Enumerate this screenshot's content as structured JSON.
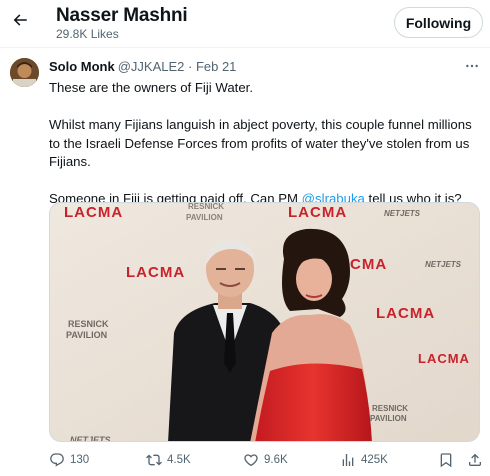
{
  "header": {
    "back_icon": "arrow-left-icon",
    "title": "Nasser Mashni",
    "subtitle": "29.8K Likes",
    "follow_label": "Following"
  },
  "post": {
    "author_name": "Solo Monk",
    "author_handle_date": "@JJKALE2 · Feb 21",
    "paragraphs": {
      "p1": "These are the owners of Fiji Water.",
      "p2": "Whilst many Fijians languish in abject poverty, this couple funnel millions to the Israeli Defense Forces from profits of water they've stolen from us Fijians.",
      "p3_before": "Someone in Fiji is getting paid off. Can PM ",
      "p3_mention": "@slrabuka",
      "p3_after": " tell us who it is?"
    },
    "media": {
      "backdrop_texts": {
        "lacma": "LACMA",
        "netjets": "NETJETS",
        "resnick": "RESNICK",
        "pavilion": "PAVILION"
      },
      "brand_color": "#c8232c"
    }
  },
  "actions": {
    "reply": {
      "icon": "reply-icon",
      "count": "130"
    },
    "repost": {
      "icon": "repost-icon",
      "count": "4.5K"
    },
    "like": {
      "icon": "heart-icon",
      "count": "9.6K"
    },
    "views": {
      "icon": "views-icon",
      "count": "425K"
    },
    "bookmark_icon": "bookmark-icon",
    "share_icon": "share-icon"
  },
  "colors": {
    "text": "#0f1419",
    "secondary": "#536471",
    "link": "#1d9bf0",
    "border": "#cfd9de"
  }
}
